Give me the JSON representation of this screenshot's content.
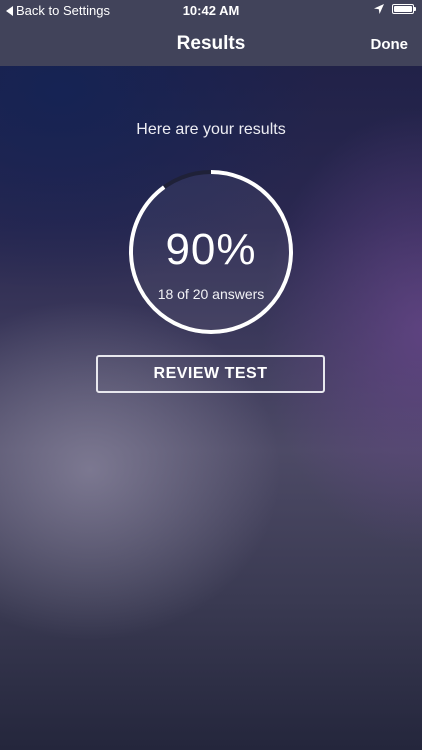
{
  "status_bar": {
    "back_label": "Back to Settings",
    "time": "10:42 AM",
    "icons": [
      "back-triangle-icon",
      "location-arrow-icon",
      "battery-icon"
    ]
  },
  "nav_bar": {
    "title": "Results",
    "done_label": "Done"
  },
  "results": {
    "intro": "Here are your results",
    "score_percent": "90%",
    "score_detail": "18 of 20 answers",
    "progress_fraction": 0.9
  },
  "actions": {
    "review_label": "REVIEW TEST"
  },
  "colors": {
    "bar_background": "#41435a",
    "ring_fill": "#ffffff",
    "ring_track": "#1f2138",
    "text": "#ffffff"
  }
}
